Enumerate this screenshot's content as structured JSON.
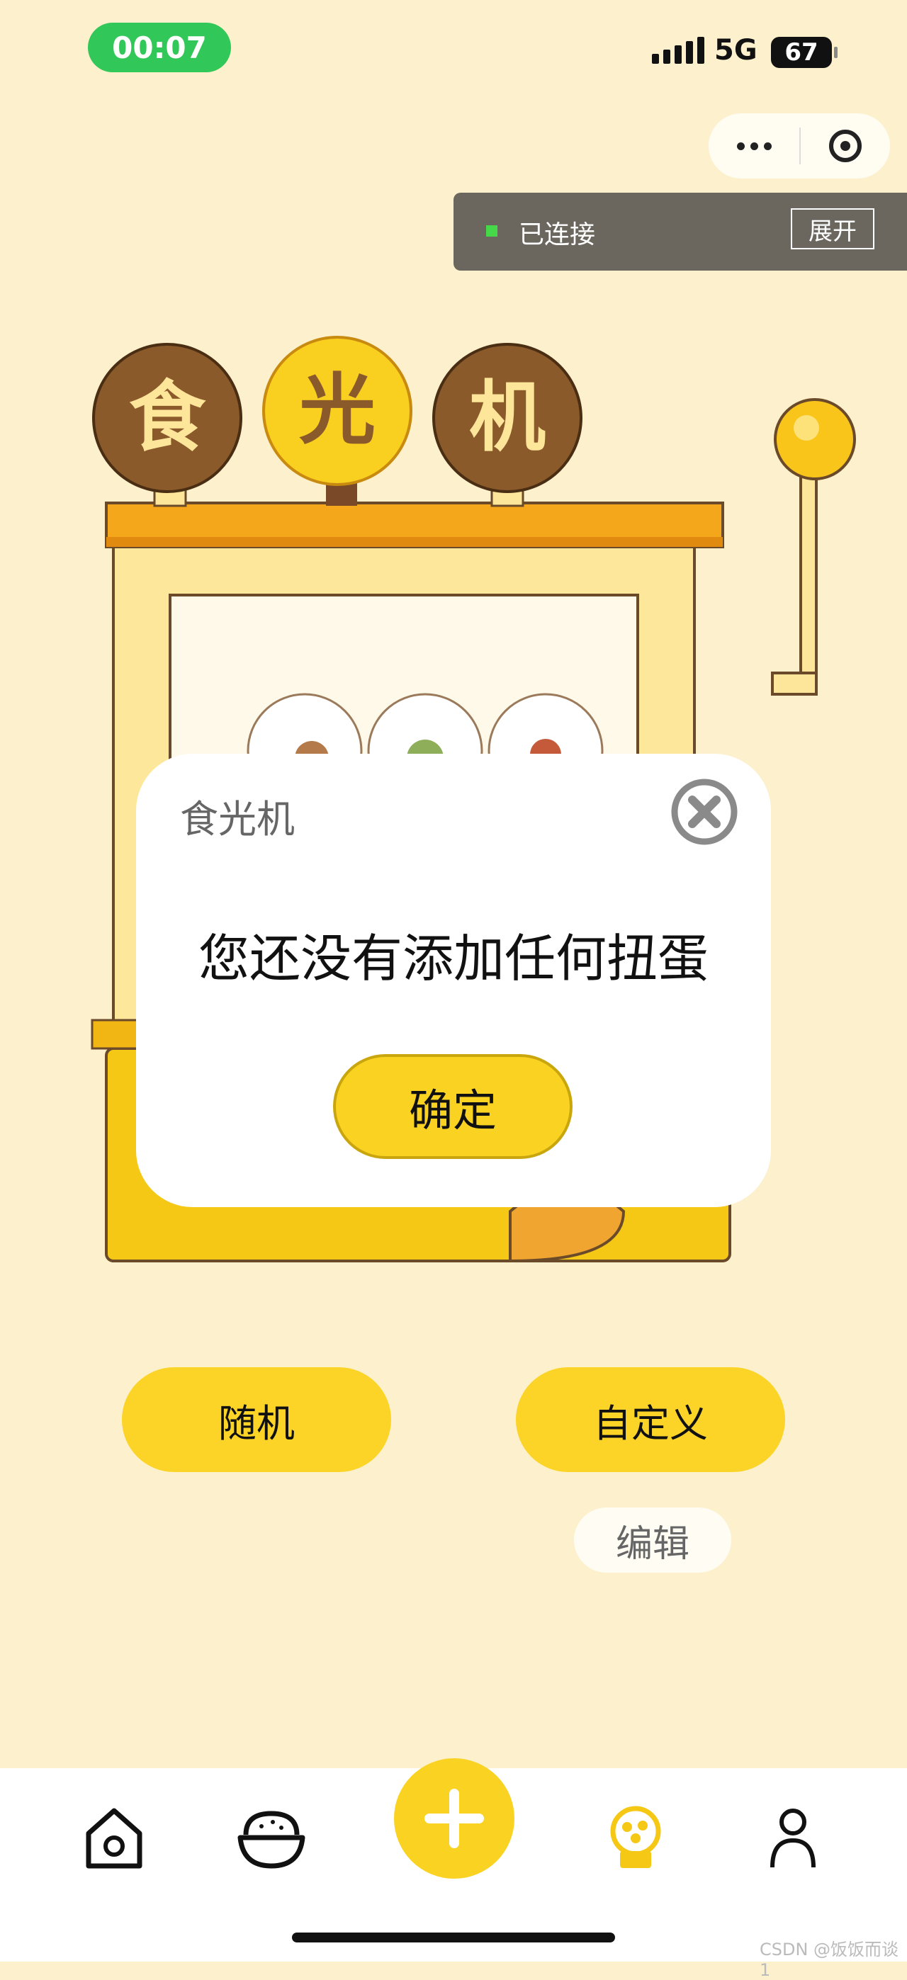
{
  "status_bar": {
    "time": "00:07",
    "network": "5G",
    "battery": "67"
  },
  "mini_program_capsule": {
    "more_icon": "more-dots-icon",
    "close_icon": "target-circle-icon"
  },
  "connection_banner": {
    "status": "已连接",
    "expand_label": "展开",
    "indicator_color": "#45d94a"
  },
  "machine": {
    "sign_chars": [
      "食",
      "光",
      "机"
    ]
  },
  "modal": {
    "title": "食光机",
    "message": "您还没有添加任何扭蛋",
    "confirm_label": "确定",
    "close_icon": "close-circle-icon"
  },
  "actions": {
    "random_label": "随机",
    "custom_label": "自定义",
    "edit_label": "编辑"
  },
  "tab_bar": {
    "items": [
      {
        "icon": "home-icon",
        "active": false
      },
      {
        "icon": "rice-bowl-icon",
        "active": false
      },
      {
        "icon": "plus-icon",
        "active": false
      },
      {
        "icon": "gacha-machine-icon",
        "active": true
      },
      {
        "icon": "user-icon",
        "active": false
      }
    ]
  },
  "watermark": "CSDN @饭饭而谈1",
  "colors": {
    "background": "#fdf0cd",
    "accent_yellow": "#f9d222",
    "brown": "#8b5a2b",
    "status_green": "#32c759"
  }
}
